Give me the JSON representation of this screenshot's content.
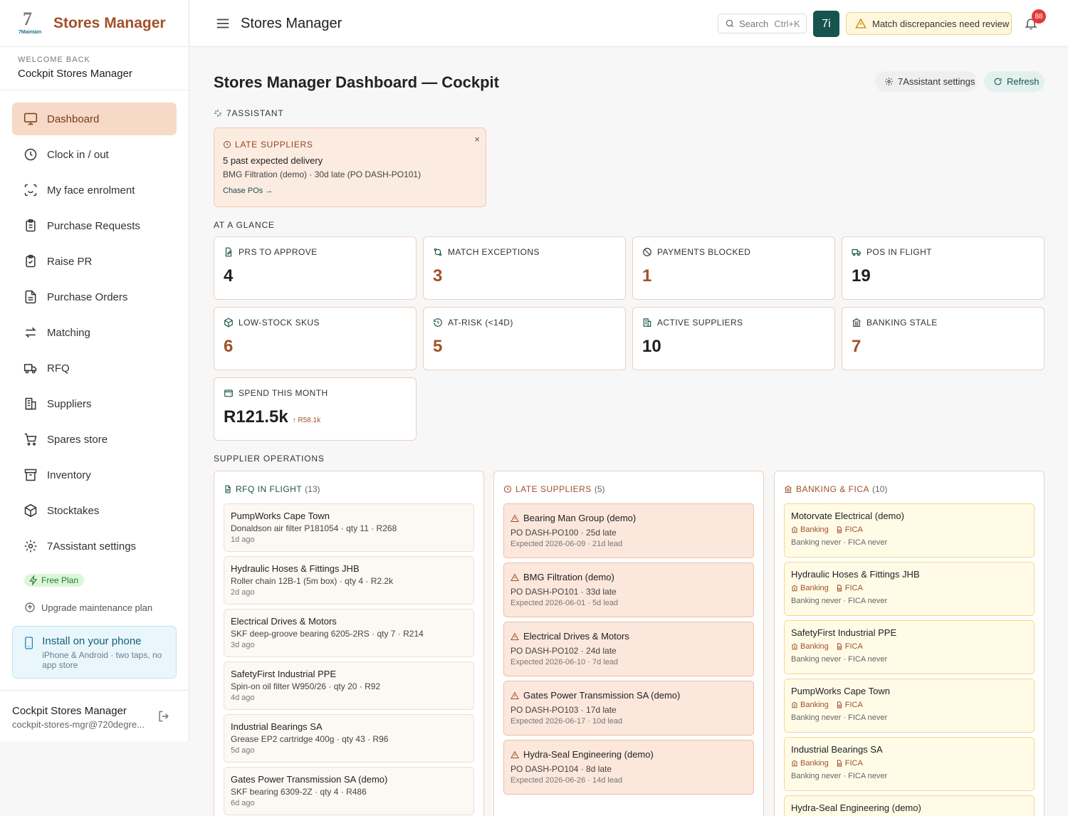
{
  "app": {
    "brand": "Stores Manager",
    "logo_digit": "7",
    "logo_sub": "7Maintain"
  },
  "sidebar": {
    "welcome_label": "WELCOME BACK",
    "welcome_name": "Cockpit Stores Manager",
    "items": [
      {
        "label": "Dashboard",
        "icon": "monitor-icon",
        "active": true
      },
      {
        "label": "Clock in / out",
        "icon": "clock-icon"
      },
      {
        "label": "My face enrolment",
        "icon": "face-scan-icon"
      },
      {
        "label": "Purchase Requests",
        "icon": "clipboard-list-icon"
      },
      {
        "label": "Raise PR",
        "icon": "clipboard-check-icon"
      },
      {
        "label": "Purchase Orders",
        "icon": "document-icon"
      },
      {
        "label": "Matching",
        "icon": "arrows-left-right-icon"
      },
      {
        "label": "RFQ",
        "icon": "truck-icon"
      },
      {
        "label": "Suppliers",
        "icon": "building-icon"
      },
      {
        "label": "Spares store",
        "icon": "cart-icon"
      },
      {
        "label": "Inventory",
        "icon": "archive-icon"
      },
      {
        "label": "Stocktakes",
        "icon": "package-icon"
      },
      {
        "label": "7Assistant settings",
        "icon": "gear-icon"
      }
    ],
    "plan_badge": "Free Plan",
    "upgrade": "Upgrade maintenance plan",
    "install_title": "Install on your phone",
    "install_sub": "iPhone & Android · two taps, no app store",
    "user_name": "Cockpit Stores Manager",
    "user_email": "cockpit-stores-mgr@720degre..."
  },
  "topbar": {
    "title": "Stores Manager",
    "search_placeholder": "Search",
    "search_shortcut": "Ctrl+K",
    "assistant_label": "7i",
    "alert_text": "Match discrepancies need review",
    "notification_count": "88"
  },
  "main": {
    "title": "Stores Manager Dashboard — Cockpit",
    "settings_btn": "7Assistant settings",
    "refresh_btn": "Refresh",
    "assistant_section": "7ASSISTANT",
    "late_card": {
      "heading": "LATE SUPPLIERS",
      "line1": "5 past expected delivery",
      "line2": "BMG Filtration (demo) · 30d late (PO DASH-PO101)",
      "action": "Chase POs →",
      "close": "×"
    },
    "glance_section": "AT A GLANCE",
    "stats": [
      {
        "label": "PRS TO APPROVE",
        "value": "4",
        "icon": "file-edit-icon",
        "accent": false
      },
      {
        "label": "MATCH EXCEPTIONS",
        "value": "3",
        "icon": "git-compare-icon",
        "accent": true
      },
      {
        "label": "PAYMENTS BLOCKED",
        "value": "1",
        "icon": "ban-icon",
        "accent": true
      },
      {
        "label": "POS IN FLIGHT",
        "value": "19",
        "icon": "truck-icon",
        "accent": false
      },
      {
        "label": "LOW-STOCK SKUS",
        "value": "6",
        "icon": "package-icon",
        "accent": true
      },
      {
        "label": "AT-RISK (<14D)",
        "value": "5",
        "icon": "clock-rotate-icon",
        "accent": true
      },
      {
        "label": "ACTIVE SUPPLIERS",
        "value": "10",
        "icon": "building-icon",
        "accent": false
      },
      {
        "label": "BANKING STALE",
        "value": "7",
        "icon": "bank-icon",
        "accent": true
      },
      {
        "label": "SPEND THIS MONTH",
        "value": "R121.5k",
        "icon": "wallet-icon",
        "accent": false,
        "delta": "↑ R58.1k"
      }
    ],
    "ops_section": "SUPPLIER OPERATIONS",
    "rfq": {
      "title": "RFQ IN FLIGHT",
      "count": "(13)",
      "items": [
        {
          "supplier": "PumpWorks Cape Town",
          "detail": "Donaldson air filter P181054 · qty 11 · R268",
          "age": "1d ago"
        },
        {
          "supplier": "Hydraulic Hoses & Fittings JHB",
          "detail": "Roller chain 12B-1 (5m box) · qty 4 · R2.2k",
          "age": "2d ago"
        },
        {
          "supplier": "Electrical Drives & Motors",
          "detail": "SKF deep-groove bearing 6205-2RS · qty 7 · R214",
          "age": "3d ago"
        },
        {
          "supplier": "SafetyFirst Industrial PPE",
          "detail": "Spin-on oil filter W950/26 · qty 20 · R92",
          "age": "4d ago"
        },
        {
          "supplier": "Industrial Bearings SA",
          "detail": "Grease EP2 cartridge 400g · qty 43 · R96",
          "age": "5d ago"
        },
        {
          "supplier": "Gates Power Transmission SA (demo)",
          "detail": "SKF bearing 6309-2Z · qty 4 · R486",
          "age": "6d ago"
        }
      ]
    },
    "late": {
      "title": "LATE SUPPLIERS",
      "count": "(5)",
      "items": [
        {
          "supplier": "Bearing Man Group (demo)",
          "po": "PO DASH-PO100 · 25d late",
          "expected": "Expected 2026-06-09 · 21d lead"
        },
        {
          "supplier": "BMG Filtration (demo)",
          "po": "PO DASH-PO101 · 33d late",
          "expected": "Expected 2026-06-01 · 5d lead"
        },
        {
          "supplier": "Electrical Drives & Motors",
          "po": "PO DASH-PO102 · 24d late",
          "expected": "Expected 2026-06-10 · 7d lead"
        },
        {
          "supplier": "Gates Power Transmission SA (demo)",
          "po": "PO DASH-PO103 · 17d late",
          "expected": "Expected 2026-06-17 · 10d lead"
        },
        {
          "supplier": "Hydra-Seal Engineering (demo)",
          "po": "PO DASH-PO104 · 8d late",
          "expected": "Expected 2026-06-26 · 14d lead"
        }
      ]
    },
    "banking": {
      "title": "BANKING & FICA",
      "count": "(10)",
      "tag_banking": "Banking",
      "tag_fica": "FICA",
      "items": [
        {
          "supplier": "Motorvate Electrical (demo)",
          "status": "Banking never · FICA never"
        },
        {
          "supplier": "Hydraulic Hoses & Fittings JHB",
          "status": "Banking never · FICA never"
        },
        {
          "supplier": "SafetyFirst Industrial PPE",
          "status": "Banking never · FICA never"
        },
        {
          "supplier": "PumpWorks Cape Town",
          "status": "Banking never · FICA never"
        },
        {
          "supplier": "Industrial Bearings SA",
          "status": "Banking never · FICA never"
        },
        {
          "supplier": "Hydra-Seal Engineering (demo)",
          "status": ""
        }
      ]
    }
  },
  "colors": {
    "brand": "#a1512a",
    "teal": "#16544d",
    "active_nav": "#f6d9c6"
  }
}
